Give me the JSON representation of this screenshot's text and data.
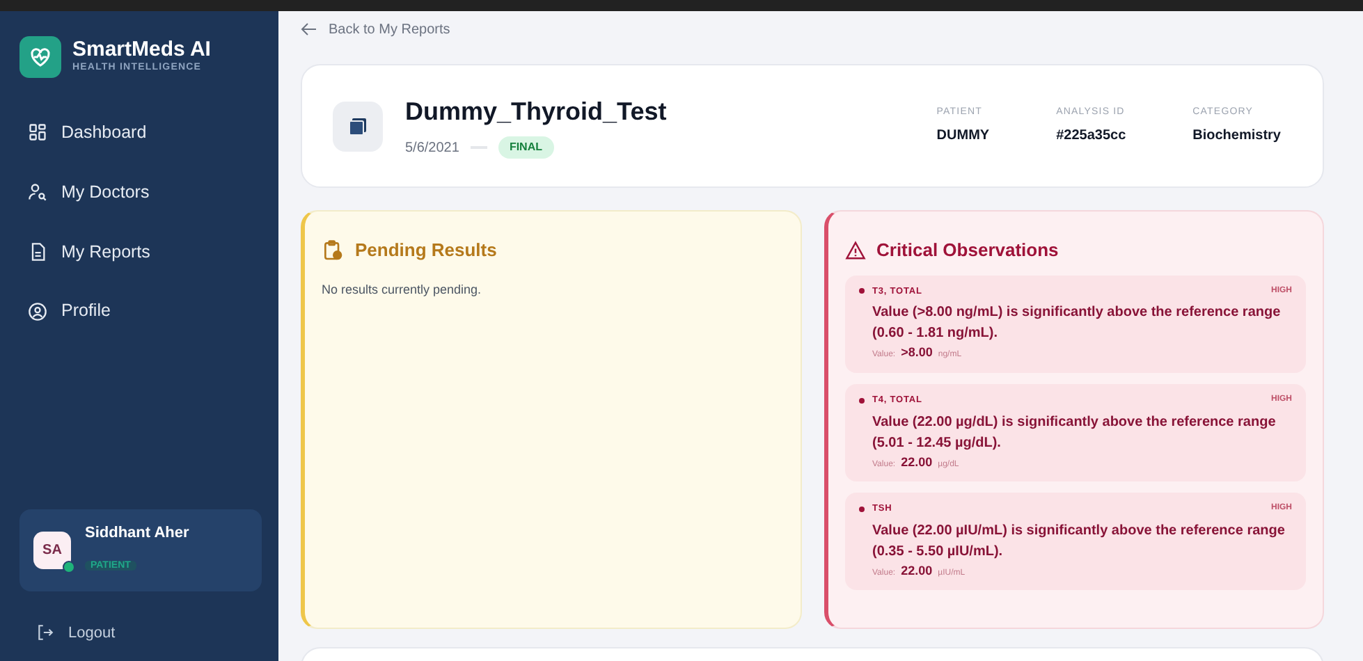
{
  "brand": {
    "name": "SmartMeds AI",
    "tagline": "HEALTH INTELLIGENCE"
  },
  "nav": [
    {
      "kind": "dashboard",
      "label": "Dashboard",
      "selected": false
    },
    {
      "kind": "doctors",
      "label": "My Doctors",
      "selected": false
    },
    {
      "kind": "reports",
      "label": "My Reports",
      "selected": false
    },
    {
      "kind": "profile",
      "label": "Profile",
      "selected": false
    }
  ],
  "user": {
    "initials": "SA",
    "name": "Siddhant Aher",
    "role": "PATIENT",
    "online": true
  },
  "logout": "Logout",
  "back_link": "Back to My Reports",
  "report": {
    "title": "Dummy_Thyroid_Test",
    "date": "5/6/2021",
    "status": "FINAL",
    "meta": [
      {
        "label": "PATIENT",
        "value": "DUMMY"
      },
      {
        "label": "ANALYSIS ID",
        "value": "#225a35cc"
      },
      {
        "label": "CATEGORY",
        "value": "Biochemistry"
      }
    ]
  },
  "pending": {
    "title": "Pending Results",
    "message": "No results currently pending."
  },
  "critical": {
    "title": "Critical Observations",
    "items": [
      {
        "test": "T3, TOTAL",
        "flag": "HIGH",
        "text": "Value (>8.00 ng/mL) is significantly above the reference range (0.60 - 1.81 ng/mL).",
        "value_label": "Value:",
        "value": ">8.00",
        "unit": "ng/mL"
      },
      {
        "test": "T4, TOTAL",
        "flag": "HIGH",
        "text": "Value (22.00 µg/dL) is significantly above the reference range (5.01 - 12.45 µg/dL).",
        "value_label": "Value:",
        "value": "22.00",
        "unit": "µg/dL"
      },
      {
        "test": "TSH",
        "flag": "HIGH",
        "text": "Value (22.00 µIU/mL) is significantly above the reference range (0.35 - 5.50 µIU/mL).",
        "value_label": "Value:",
        "value": "22.00",
        "unit": "µIU/mL"
      }
    ]
  }
}
